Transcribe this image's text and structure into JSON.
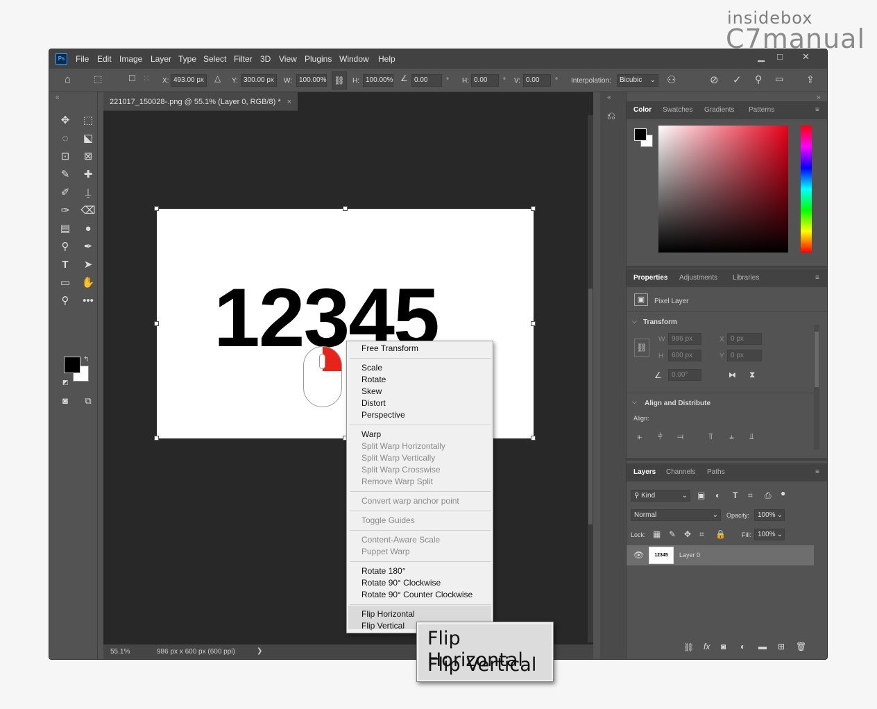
{
  "watermark": {
    "line1": "insidebox",
    "line2": "C7manual"
  },
  "app": {
    "logo": "Ps",
    "menu": [
      "File",
      "Edit",
      "Image",
      "Layer",
      "Type",
      "Select",
      "Filter",
      "3D",
      "View",
      "Plugins",
      "Window",
      "Help"
    ],
    "window_controls": [
      "minimize-icon",
      "maximize-icon",
      "close-icon"
    ]
  },
  "options": {
    "x_label": "X:",
    "x_value": "493.00 px",
    "y_label": "Y:",
    "y_value": "300.00 px",
    "w_label": "W:",
    "w_value": "100.00%",
    "h_label": "H:",
    "h_value": "100.00%",
    "angle_value": "0.00",
    "angle_unit": "°",
    "hskew_label": "H:",
    "hskew_value": "0.00",
    "hskew_unit": "°",
    "vskew_label": "V:",
    "vskew_value": "0.00",
    "vskew_unit": "°",
    "interp_label": "Interpolation:",
    "interp_value": "Bicubic"
  },
  "document": {
    "tab_title": "221017_150028-.png @ 55.1% (Layer 0, RGB/8) *",
    "tab_close": "×",
    "canvas_text": "12345",
    "status_zoom": "55.1%",
    "status_info": "986 px x 600 px (600 ppi)",
    "status_arrow": "❯"
  },
  "panels": {
    "collapse_left": "«",
    "collapse_right": "»",
    "color_tabs": [
      "Color",
      "Swatches",
      "Gradients",
      "Patterns"
    ],
    "props_tabs": [
      "Properties",
      "Adjustments",
      "Libraries"
    ],
    "props_type": "Pixel Layer",
    "transform_title": "Transform",
    "w_label": "W",
    "w_value": "986 px",
    "x_label": "X",
    "x_value": "0 px",
    "h_label": "H",
    "h_value": "600 px",
    "y_label": "Y",
    "y_value": "0 px",
    "rot_value": "0.00°",
    "align_title": "Align and Distribute",
    "align_label": "Align:",
    "layer_tabs": [
      "Layers",
      "Channels",
      "Paths"
    ],
    "kind": "Kind",
    "blend": "Normal",
    "opacity_label": "Opacity:",
    "opacity_value": "100%",
    "lock_label": "Lock:",
    "fill_label": "Fill:",
    "fill_value": "100%",
    "layer_name": "Layer 0",
    "layer_thumb": "12345"
  },
  "context_menu": {
    "items": [
      {
        "label": "Free Transform",
        "disabled": false
      },
      {
        "label": "Scale",
        "disabled": false
      },
      {
        "label": "Rotate",
        "disabled": false
      },
      {
        "label": "Skew",
        "disabled": false
      },
      {
        "label": "Distort",
        "disabled": false
      },
      {
        "label": "Perspective",
        "disabled": false
      },
      {
        "label": "Warp",
        "disabled": false
      },
      {
        "label": "Split Warp Horizontally",
        "disabled": true
      },
      {
        "label": "Split Warp Vertically",
        "disabled": true
      },
      {
        "label": "Split Warp Crosswise",
        "disabled": true
      },
      {
        "label": "Remove Warp Split",
        "disabled": true
      },
      {
        "label": "Convert warp anchor point",
        "disabled": true
      },
      {
        "label": "Toggle Guides",
        "disabled": true
      },
      {
        "label": "Content-Aware Scale",
        "disabled": true
      },
      {
        "label": "Puppet Warp",
        "disabled": true
      },
      {
        "label": "Rotate 180°",
        "disabled": false
      },
      {
        "label": "Rotate 90° Clockwise",
        "disabled": false
      },
      {
        "label": "Rotate 90° Counter Clockwise",
        "disabled": false
      },
      {
        "label": "Flip Horizontal",
        "disabled": false
      },
      {
        "label": "Flip Vertical",
        "disabled": false
      }
    ]
  },
  "zoom_callout": {
    "line1": "Flip Horizontal",
    "line2": "Flip Vertical"
  },
  "colors": {
    "foreground": "#000000",
    "background": "#ffffff",
    "accent": "#31a8ff",
    "mouse_button": "#e8231a"
  }
}
